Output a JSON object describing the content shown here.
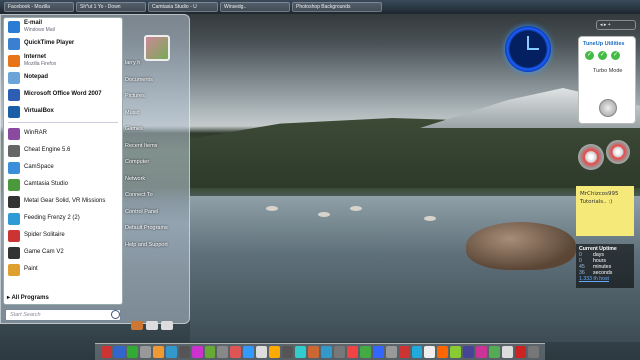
{
  "taskbar": {
    "items": [
      "Facebook - Mozilla",
      "Sh*ut 1 Yo - Down",
      "Camtasia Studio - U",
      "Winsedg..",
      "Photoshop Backgrounds"
    ]
  },
  "start_menu": {
    "pinned": [
      {
        "title": "E-mail",
        "sub": "Windows Mail",
        "icon": "mail-icon",
        "color": "#2a7bd4"
      },
      {
        "title": "QuickTime Player",
        "sub": "",
        "icon": "quicktime-icon",
        "color": "#3a7fd0"
      },
      {
        "title": "Internet",
        "sub": "Mozilla Firefox",
        "icon": "firefox-icon",
        "color": "#e8741a"
      },
      {
        "title": "Notepad",
        "sub": "",
        "icon": "notepad-icon",
        "color": "#6aa4d8"
      },
      {
        "title": "Microsoft Office Word 2007",
        "sub": "",
        "icon": "word-icon",
        "color": "#2c5fb3"
      },
      {
        "title": "VirtualBox",
        "sub": "",
        "icon": "virtualbox-icon",
        "color": "#1b5ea8"
      }
    ],
    "recent": [
      {
        "title": "WinRAR",
        "icon": "winrar-icon",
        "color": "#8a4aa0"
      },
      {
        "title": "Cheat Engine 5.6",
        "icon": "cheat-engine-icon",
        "color": "#666"
      },
      {
        "title": "CamSpace",
        "icon": "camspace-icon",
        "color": "#3b8ed8"
      },
      {
        "title": "Camtasia Studio",
        "icon": "camtasia-icon",
        "color": "#4a9a3c"
      },
      {
        "title": "Metal Gear Solid, VR Missions",
        "icon": "mgs-icon",
        "color": "#333"
      },
      {
        "title": "Feeding Frenzy 2 (2)",
        "icon": "feeding-frenzy-icon",
        "color": "#2e9bd6"
      },
      {
        "title": "Spider Solitaire",
        "icon": "solitaire-icon",
        "color": "#c33"
      },
      {
        "title": "Game Cam V2",
        "icon": "gamecam-icon",
        "color": "#333"
      },
      {
        "title": "Paint",
        "icon": "paint-icon",
        "color": "#e0a030"
      }
    ],
    "all_programs": "All Programs",
    "search_placeholder": "Start Search",
    "right_items": [
      "larry h",
      "Documents",
      "Pictures",
      "Music",
      "Games",
      "Recent Items",
      "Computer",
      "Network",
      "Connect To",
      "Control Panel",
      "Default Programs",
      "Help and Support"
    ]
  },
  "gadgets": {
    "tuneup_title": "TuneUp Utilities",
    "turbo_label": "Turbo Mode",
    "note_text": "MrChizcos995 Tutorials.. :)",
    "uptime": {
      "title": "Current Uptime",
      "rows": [
        {
          "n": "0",
          "u": "days"
        },
        {
          "n": "0",
          "u": "hours"
        },
        {
          "n": "45",
          "u": "minutes"
        },
        {
          "n": "36",
          "u": "seconds"
        }
      ],
      "link": "1.333 th host"
    }
  }
}
